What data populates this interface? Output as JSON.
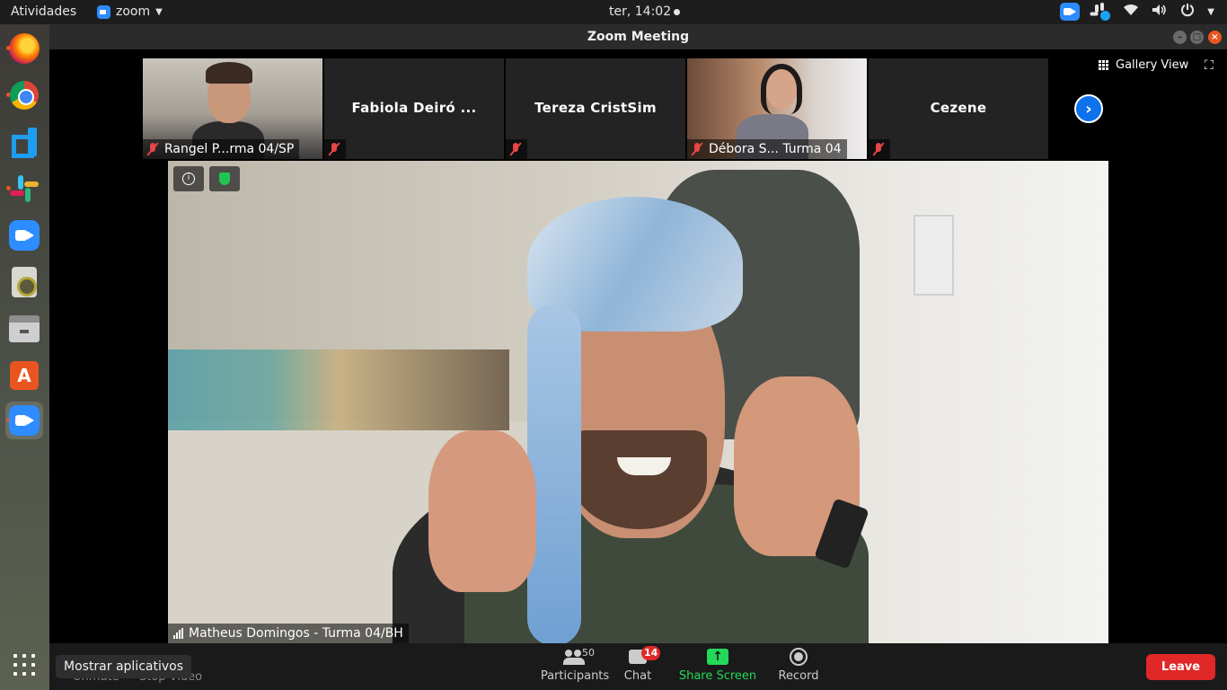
{
  "topbar": {
    "activities": "Atividades",
    "app_name": "zoom",
    "clock": "ter, 14:02"
  },
  "dock": {
    "items": [
      "firefox-icon",
      "chrome-icon",
      "vscode-icon",
      "slack-icon",
      "zoom-icon",
      "speaker-app-icon",
      "files-icon",
      "app-store-icon",
      "zoom-icon"
    ],
    "tooltip": "Mostrar aplicativos"
  },
  "window": {
    "title": "Zoom Meeting"
  },
  "gallery": {
    "view_label": "Gallery View",
    "thumbnails": [
      {
        "name": "Rangel P...rma 04/SP",
        "center_name": "",
        "has_video": true
      },
      {
        "name": "",
        "center_name": "Fabiola Deiró ...",
        "has_video": false
      },
      {
        "name": "",
        "center_name": "Tereza CristSim",
        "has_video": false
      },
      {
        "name": "Débora S... Turma 04",
        "center_name": "",
        "has_video": true
      },
      {
        "name": "",
        "center_name": "Cezene",
        "has_video": false
      }
    ]
  },
  "main_video": {
    "speaker_name": "Matheus Domingos - Turma 04/BH"
  },
  "toolbar": {
    "unmute": "Unmute",
    "stop_video": "Stop Video",
    "participants": "Participants",
    "participants_count": "50",
    "chat": "Chat",
    "chat_badge": "14",
    "share_screen": "Share Screen",
    "record": "Record",
    "leave": "Leave"
  },
  "colors": {
    "accent": "#2d8cff",
    "leave": "#e02828",
    "share": "#23d959",
    "muted": "#e84545"
  }
}
